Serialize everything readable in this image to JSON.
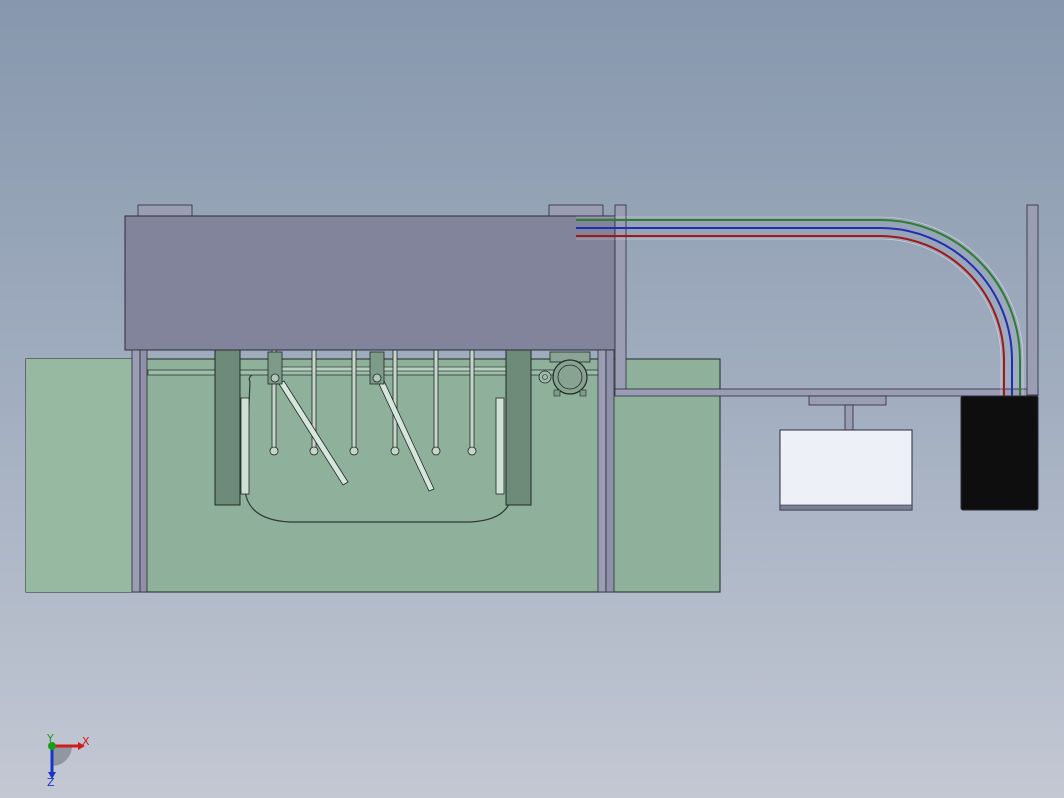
{
  "viewport": {
    "background_top": "#8797ad",
    "background_bottom": "#c3c8d3"
  },
  "colors": {
    "tank_fill": "#8fb09b",
    "tank_stroke": "#1f2a24",
    "lid_fill": "#81849b",
    "frame_fill": "#9a9db4",
    "pipe_green": "#2e7d32",
    "pipe_blue": "#1f2fb0",
    "pipe_red": "#a01818",
    "reservoir_black": "#0e0e0e",
    "tray_white": "#eef0f7"
  },
  "axis_triad": {
    "x_label": "X",
    "y_label": "Y",
    "z_label": "Z",
    "x_color": "#d11a1a",
    "y_color": "#1a9d1a",
    "z_color": "#1a34c8"
  }
}
